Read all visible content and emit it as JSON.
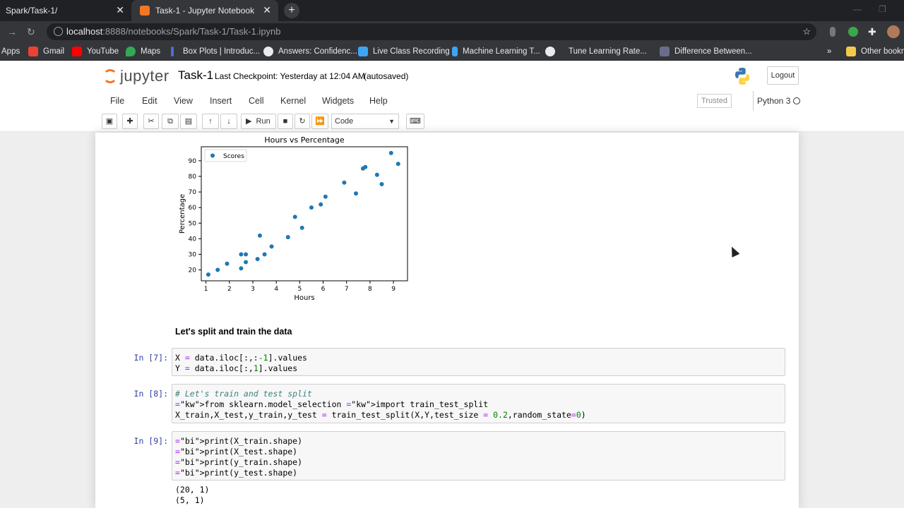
{
  "browser": {
    "tabs": [
      {
        "title": "Spark/Task-1/",
        "active": false
      },
      {
        "title": "Task-1 - Jupyter Notebook",
        "active": true
      }
    ],
    "url_host": "localhost",
    "url_path": ":8888/notebooks/Spark/Task-1/Task-1.ipynb",
    "bookmarks": [
      "Apps",
      "Gmail",
      "YouTube",
      "Maps",
      "Box Plots | Introduc...",
      "Answers: Confidenc...",
      "Live Class Recording",
      "Machine Learning T...",
      "Tune Learning Rate...",
      "Difference Between...",
      "»",
      "Other bookm"
    ]
  },
  "jupyter": {
    "logo_text": "jupyter",
    "notebook_name": "Task-1",
    "checkpoint": "Last Checkpoint: Yesterday at 12:04 AM",
    "autosave": "(autosaved)",
    "logout": "Logout",
    "menu": [
      "File",
      "Edit",
      "View",
      "Insert",
      "Cell",
      "Kernel",
      "Widgets",
      "Help"
    ],
    "trusted": "Trusted",
    "kernel": "Python 3",
    "toolbar": {
      "run_label": "Run",
      "cell_type": "Code"
    }
  },
  "chart_data": {
    "type": "scatter",
    "title": "Hours vs Percentage",
    "xlabel": "Hours",
    "ylabel": "Percentage",
    "xlim": [
      0.8,
      9.6
    ],
    "ylim": [
      13,
      99
    ],
    "xticks": [
      1,
      2,
      3,
      4,
      5,
      6,
      7,
      8,
      9
    ],
    "yticks": [
      20,
      30,
      40,
      50,
      60,
      70,
      80,
      90
    ],
    "legend": "top-left",
    "color": "#1f77b4",
    "series": [
      {
        "name": "Scores",
        "x": [
          2.5,
          5.1,
          3.2,
          8.5,
          3.5,
          1.5,
          9.2,
          5.5,
          8.3,
          2.7,
          7.7,
          5.9,
          4.5,
          3.3,
          1.1,
          8.9,
          2.5,
          1.9,
          6.1,
          7.4,
          2.7,
          4.8,
          3.8,
          6.9,
          7.8
        ],
        "y": [
          21,
          47,
          27,
          75,
          30,
          20,
          88,
          60,
          81,
          25,
          85,
          62,
          41,
          42,
          17,
          95,
          30,
          24,
          67,
          69,
          30,
          54,
          35,
          76,
          86
        ]
      }
    ]
  },
  "cells": {
    "markdown": "Let's split and train the data",
    "c7": {
      "prompt": "In [7]:",
      "lines": [
        "X = data.iloc[:,:-1].values",
        "Y = data.iloc[:,1].values"
      ]
    },
    "c8": {
      "prompt": "In [8]:",
      "lines": [
        "# Let's train and test split",
        "from sklearn.model_selection import train_test_split",
        "X_train,X_test,y_train,y_test = train_test_split(X,Y,test_size = 0.2,random_state=0)"
      ]
    },
    "c9": {
      "prompt": "In [9]:",
      "lines": [
        "print(X_train.shape)",
        "print(X_test.shape)",
        "print(y_train.shape)",
        "print(y_test.shape)"
      ],
      "output": [
        "(20, 1)",
        "(5, 1)"
      ]
    }
  }
}
